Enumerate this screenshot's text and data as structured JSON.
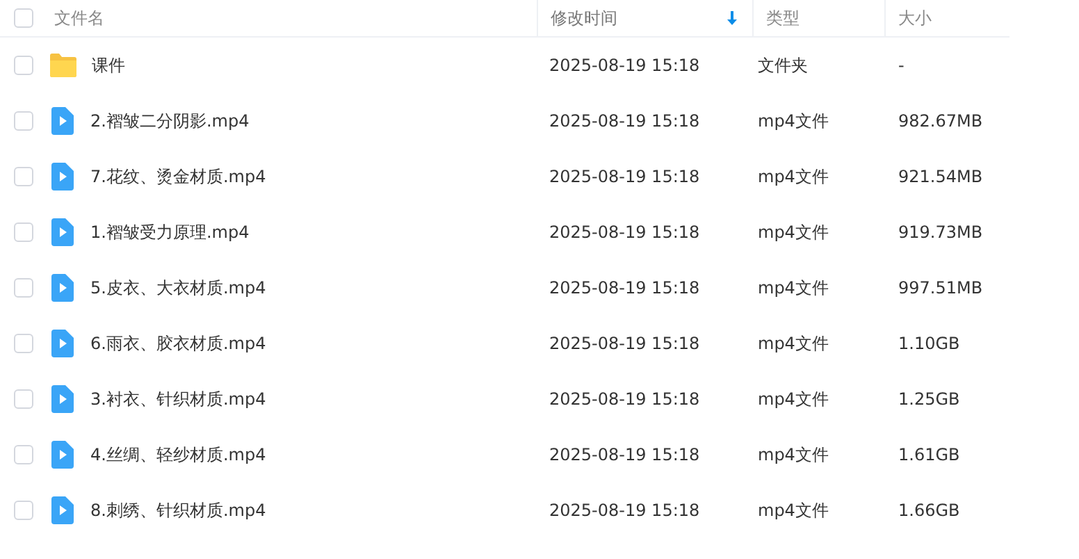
{
  "header": {
    "select_all": {
      "checked": false
    },
    "columns": [
      {
        "label": "文件名",
        "sorted": false
      },
      {
        "label": "修改时间",
        "sorted": true
      },
      {
        "label": "类型",
        "sorted": false
      },
      {
        "label": "大小",
        "sorted": false
      }
    ]
  },
  "files": [
    {
      "kind": "folder",
      "name": "课件",
      "modified": "2025-08-19 15:18",
      "type": "文件夹",
      "size": "-",
      "checked": false
    },
    {
      "kind": "video",
      "name": "2.褶皱二分阴影.mp4",
      "modified": "2025-08-19 15:18",
      "type": "mp4文件",
      "size": "982.67MB",
      "checked": false
    },
    {
      "kind": "video",
      "name": "7.花纹、烫金材质.mp4",
      "modified": "2025-08-19 15:18",
      "type": "mp4文件",
      "size": "921.54MB",
      "checked": false
    },
    {
      "kind": "video",
      "name": "1.褶皱受力原理.mp4",
      "modified": "2025-08-19 15:18",
      "type": "mp4文件",
      "size": "919.73MB",
      "checked": false
    },
    {
      "kind": "video",
      "name": "5.皮衣、大衣材质.mp4",
      "modified": "2025-08-19 15:18",
      "type": "mp4文件",
      "size": "997.51MB",
      "checked": false
    },
    {
      "kind": "video",
      "name": "6.雨衣、胶衣材质.mp4",
      "modified": "2025-08-19 15:18",
      "type": "mp4文件",
      "size": "1.10GB",
      "checked": false
    },
    {
      "kind": "video",
      "name": "3.衬衣、针织材质.mp4",
      "modified": "2025-08-19 15:18",
      "type": "mp4文件",
      "size": "1.25GB",
      "checked": false
    },
    {
      "kind": "video",
      "name": "4.丝绸、轻纱材质.mp4",
      "modified": "2025-08-19 15:18",
      "type": "mp4文件",
      "size": "1.61GB",
      "checked": false
    },
    {
      "kind": "video",
      "name": "8.刺绣、针织材质.mp4",
      "modified": "2025-08-19 15:18",
      "type": "mp4文件",
      "size": "1.66GB",
      "checked": false
    }
  ]
}
